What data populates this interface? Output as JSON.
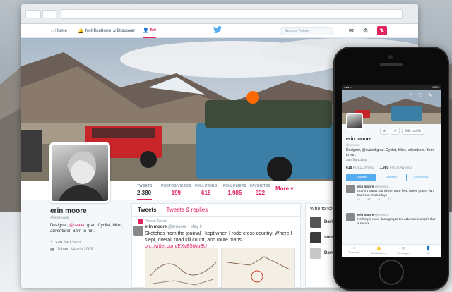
{
  "topbar": {
    "nav": [
      {
        "label": "Home",
        "icon": "home-icon",
        "glyph": "⌂"
      },
      {
        "label": "Notifications",
        "icon": "bell-icon",
        "glyph": "🔔"
      },
      {
        "label": "Discover",
        "icon": "hashtag-icon",
        "glyph": "#"
      },
      {
        "label": "Me",
        "icon": "person-icon",
        "glyph": "👤"
      }
    ],
    "search_placeholder": "Search Twitter",
    "compose_glyph": "✎"
  },
  "profile": {
    "name": "erin moore",
    "handle": "@emoore",
    "bio_prefix": "Designer, ",
    "bio_mention": "@svaied",
    "bio_suffix": " grad. Cyclist, hiker, adventurer. Born to run.",
    "location": "san francisco",
    "joined": "Joined March 2009"
  },
  "stats": [
    {
      "label": "TWEETS",
      "value": "2,380"
    },
    {
      "label": "PHOTOS/VIDEOS",
      "value": "199"
    },
    {
      "label": "FOLLOWING",
      "value": "618"
    },
    {
      "label": "FOLLOWERS",
      "value": "1,985"
    },
    {
      "label": "FAVORITES",
      "value": "922"
    },
    {
      "label": "",
      "value": "More ▾"
    }
  ],
  "timeline": {
    "tab_tweets": "Tweets",
    "tab_replies": "Tweets & replies",
    "pinned_label": "Pinned Tweet",
    "tweet": {
      "name": "erin moore",
      "handle": "@emoore · May 6",
      "text": "Sketches from the journal I kept when I rode cross country. Where I slept, overall road kill count, and route maps.",
      "link": "pic.twitter.com/EXyB5tAgBU"
    }
  },
  "who_to_follow": {
    "title": "Who to foll",
    "rows": [
      {
        "name": "Davi"
      },
      {
        "name": "soto"
      },
      {
        "name": "Dave"
      }
    ]
  },
  "phone": {
    "status_left": "●●●●○",
    "status_right": "100%",
    "edit_profile": "Edit profile",
    "name": "erin moore",
    "handle": "@emoore",
    "bio": "Designer, @svaied grad. Cyclist, hiker, adventurer. Born to run.",
    "location": "san francisco",
    "following_n": "618",
    "following_l": "FOLLOWING",
    "followers_n": "1,985",
    "followers_l": "FOLLOWERS",
    "tabs": [
      "Tweets",
      "Photos",
      "Favorites"
    ],
    "tweets": [
      {
        "name": "erin moore",
        "handle": "@emoore",
        "text": "Current status: Sunshine. Bare feet. Green grass. Van Morrison. #saturdays",
        "time": "1d"
      },
      {
        "name": "erin moore",
        "handle": "@emoore",
        "text": "Nothing is more damaging to the adventurous spirit than a secure",
        "time": ""
      }
    ],
    "tabbar": [
      {
        "label": "Timelines",
        "glyph": "⌂"
      },
      {
        "label": "Notifications",
        "glyph": "🔔"
      },
      {
        "label": "Messages",
        "glyph": "✉"
      },
      {
        "label": "Me",
        "glyph": "👤"
      }
    ]
  },
  "colors": {
    "accent": "#e0245e",
    "twitter_blue": "#55acee"
  }
}
